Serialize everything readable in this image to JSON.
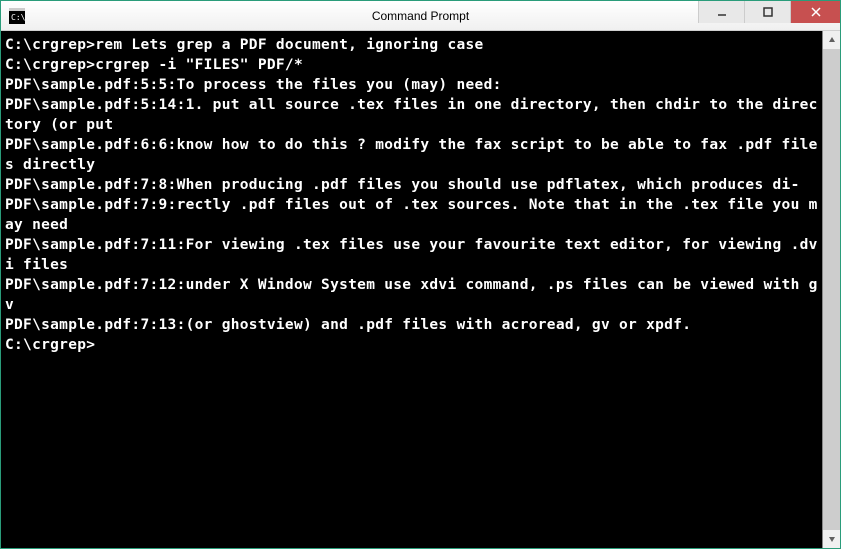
{
  "window": {
    "title": "Command Prompt"
  },
  "terminal": {
    "lines": [
      "",
      "C:\\crgrep>rem Lets grep a PDF document, ignoring case",
      "",
      "C:\\crgrep>crgrep -i \"FILES\" PDF/*",
      "PDF\\sample.pdf:5:5:To process the files you (may) need:",
      "PDF\\sample.pdf:5:14:1. put all source .tex files in one directory, then chdir to the directory (or put",
      "PDF\\sample.pdf:6:6:know how to do this ? modify the fax script to be able to fax .pdf files directly",
      "PDF\\sample.pdf:7:8:When producing .pdf files you should use pdflatex, which produces di-",
      "PDF\\sample.pdf:7:9:rectly .pdf files out of .tex sources. Note that in the .tex file you may need",
      "PDF\\sample.pdf:7:11:For viewing .tex files use your favourite text editor, for viewing .dvi files",
      "PDF\\sample.pdf:7:12:under X Window System use xdvi command, .ps files can be viewed with gv",
      "PDF\\sample.pdf:7:13:(or ghostview) and .pdf files with acroread, gv or xpdf.",
      "",
      "C:\\crgrep>"
    ]
  }
}
